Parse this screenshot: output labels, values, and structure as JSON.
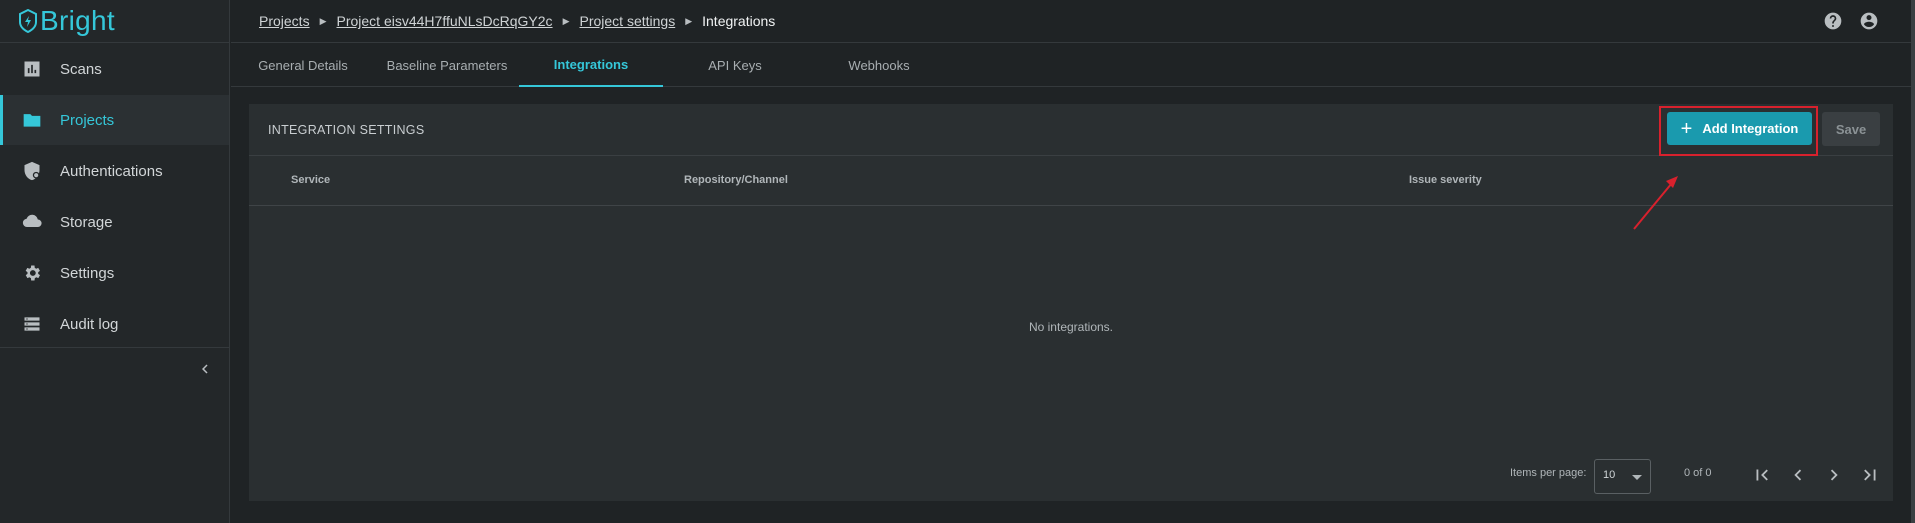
{
  "app": {
    "logo": "Bright"
  },
  "sidebar": {
    "items": [
      {
        "label": "Scans",
        "icon": "chart-icon"
      },
      {
        "label": "Projects",
        "icon": "folder-icon",
        "active": true
      },
      {
        "label": "Authentications",
        "icon": "shield-icon"
      },
      {
        "label": "Storage",
        "icon": "cloud-icon"
      },
      {
        "label": "Settings",
        "icon": "gear-icon"
      },
      {
        "label": "Audit log",
        "icon": "list-icon"
      }
    ]
  },
  "breadcrumb": {
    "items": [
      "Projects",
      "Project eisv44H7ffuNLsDcRqGY2c",
      "Project settings"
    ],
    "current": "Integrations"
  },
  "tabs": [
    "General Details",
    "Baseline Parameters",
    "Integrations",
    "API Keys",
    "Webhooks"
  ],
  "active_tab": "Integrations",
  "integration_settings": {
    "title": "INTEGRATION SETTINGS",
    "add_label": "Add Integration",
    "save_label": "Save",
    "columns": [
      "Service",
      "Repository/Channel",
      "Issue severity"
    ],
    "empty_message": "No integrations."
  },
  "paginator": {
    "items_per_page_label": "Items per page:",
    "page_size": "10",
    "range": "0 of 0"
  },
  "colors": {
    "accent": "#35c7d9",
    "button": "#1a9aae",
    "highlight": "#d8212d"
  }
}
